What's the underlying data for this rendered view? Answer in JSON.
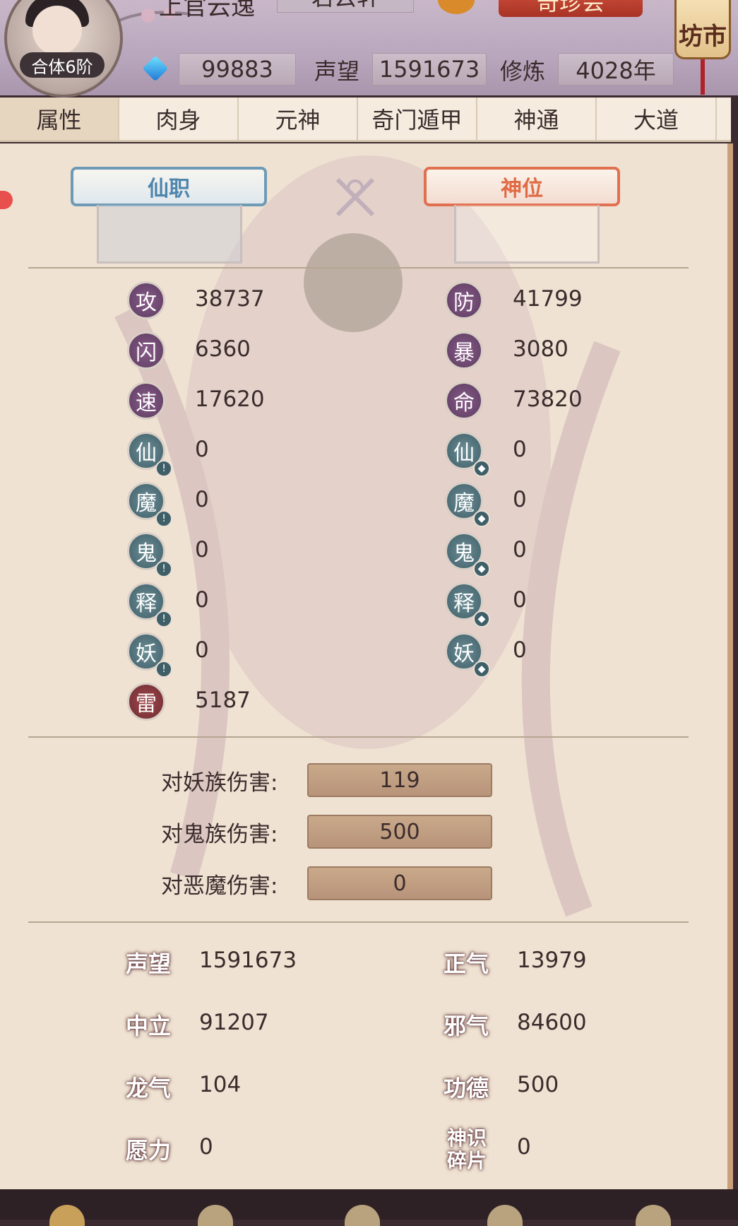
{
  "header": {
    "top_name": "上官云逸",
    "top_box": "若云轩",
    "red_button": "奇珍会",
    "market": "坊市",
    "level": "合体6阶",
    "gems": "99883",
    "fame_label": "声望",
    "fame_value": "1591673",
    "cultivation_label": "修炼",
    "cultivation_value": "4028年"
  },
  "tabs": [
    "属性",
    "肉身",
    "元神",
    "奇门遁甲",
    "神通",
    "大道"
  ],
  "plaques": {
    "xianzhi": "仙职",
    "shenwei": "神位"
  },
  "stats_left": [
    {
      "icon": "攻",
      "value": "38737",
      "color": "purple"
    },
    {
      "icon": "闪",
      "value": "6360",
      "color": "purple"
    },
    {
      "icon": "速",
      "value": "17620",
      "color": "purple"
    },
    {
      "icon": "仙",
      "value": "0",
      "color": "teal"
    },
    {
      "icon": "魔",
      "value": "0",
      "color": "teal"
    },
    {
      "icon": "鬼",
      "value": "0",
      "color": "teal"
    },
    {
      "icon": "释",
      "value": "0",
      "color": "teal"
    },
    {
      "icon": "妖",
      "value": "0",
      "color": "teal"
    },
    {
      "icon": "雷",
      "value": "5187",
      "color": "red"
    }
  ],
  "stats_right": [
    {
      "icon": "防",
      "value": "41799",
      "color": "purple"
    },
    {
      "icon": "暴",
      "value": "3080",
      "color": "purple"
    },
    {
      "icon": "命",
      "value": "73820",
      "color": "purple"
    },
    {
      "icon": "仙",
      "value": "0",
      "color": "teal"
    },
    {
      "icon": "魔",
      "value": "0",
      "color": "teal"
    },
    {
      "icon": "鬼",
      "value": "0",
      "color": "teal"
    },
    {
      "icon": "释",
      "value": "0",
      "color": "teal"
    },
    {
      "icon": "妖",
      "value": "0",
      "color": "teal"
    }
  ],
  "damage": [
    {
      "label": "对妖族伤害:",
      "value": "119"
    },
    {
      "label": "对鬼族伤害:",
      "value": "500"
    },
    {
      "label": "对恶魔伤害:",
      "value": "0"
    }
  ],
  "reputation_left": [
    {
      "label": "声望",
      "value": "1591673"
    },
    {
      "label": "中立",
      "value": "91207"
    },
    {
      "label": "龙气",
      "value": "104"
    },
    {
      "label": "愿力",
      "value": "0"
    }
  ],
  "reputation_right": [
    {
      "label": "正气",
      "value": "13979"
    },
    {
      "label": "邪气",
      "value": "84600"
    },
    {
      "label": "功德",
      "value": "500"
    },
    {
      "label": "神识碎片",
      "value": "0"
    }
  ],
  "colors": {
    "purple": "#6e4a72",
    "teal": "#4e6f79",
    "red": "#8a373c",
    "xianzhi": "#4f86ad",
    "shenwei": "#e06a44"
  }
}
